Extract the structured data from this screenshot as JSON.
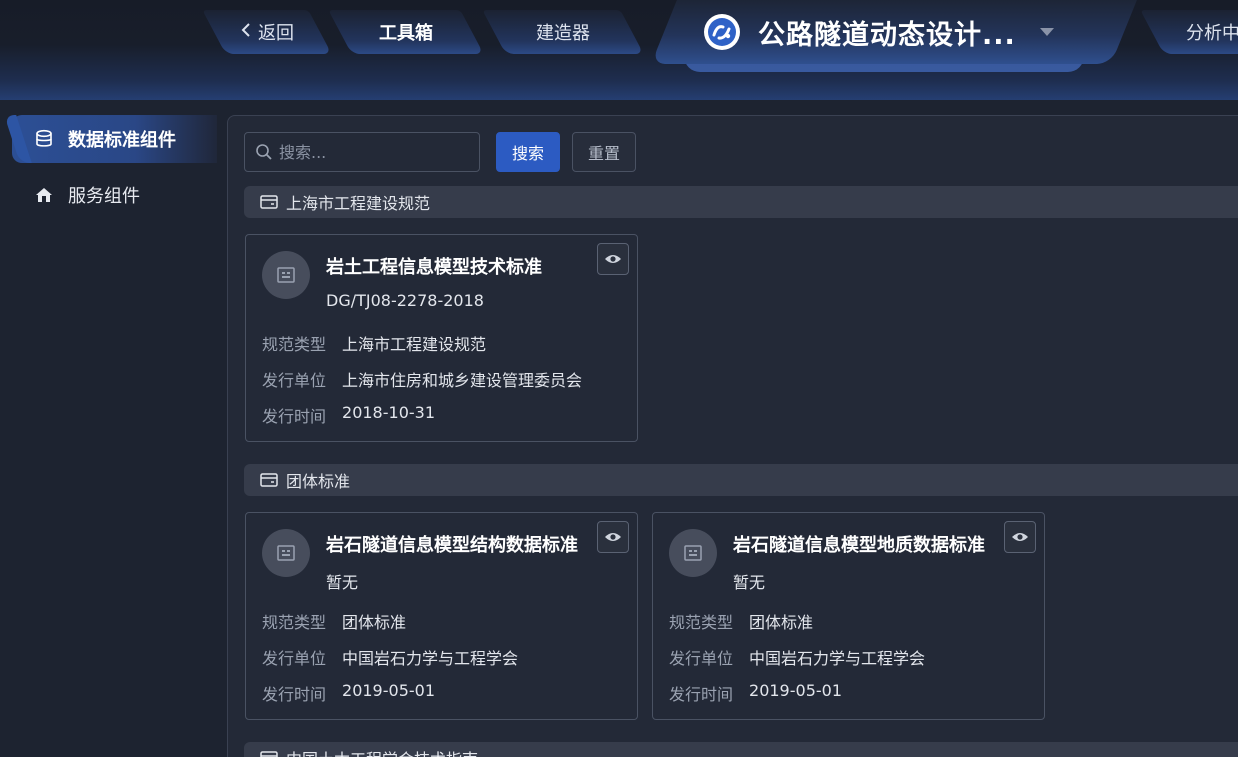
{
  "nav": {
    "back_label": "返回",
    "toolbox_label": "工具箱",
    "builder_label": "建造器",
    "project_title": "公路隧道动态设计...",
    "analysis_label": "分析中"
  },
  "sidebar": {
    "items": [
      {
        "label": "数据标准组件",
        "icon": "database-icon",
        "active": true
      },
      {
        "label": "服务组件",
        "icon": "home-icon",
        "active": false
      }
    ]
  },
  "search": {
    "placeholder": "搜索...",
    "search_label": "搜索",
    "reset_label": "重置"
  },
  "field_labels": {
    "type": "规范类型",
    "issuer": "发行单位",
    "date": "发行时间"
  },
  "groups": [
    {
      "title": "上海市工程建设规范",
      "cards": [
        {
          "name": "岩土工程信息模型技术标准",
          "code": "DG/TJ08-2278-2018",
          "type": "上海市工程建设规范",
          "issuer": "上海市住房和城乡建设管理委员会",
          "date": "2018-10-31"
        }
      ]
    },
    {
      "title": "团体标准",
      "cards": [
        {
          "name": "岩石隧道信息模型结构数据标准",
          "code": "暂无",
          "type": "团体标准",
          "issuer": "中国岩石力学与工程学会",
          "date": "2019-05-01"
        },
        {
          "name": "岩石隧道信息模型地质数据标准",
          "code": "暂无",
          "type": "团体标准",
          "issuer": "中国岩石力学与工程学会",
          "date": "2019-05-01"
        }
      ]
    },
    {
      "title": "中国土木工程学会技术指南",
      "cards": []
    }
  ],
  "colors": {
    "accent": "#2c5bc2",
    "background": "#1d2330",
    "panel": "#232937"
  }
}
